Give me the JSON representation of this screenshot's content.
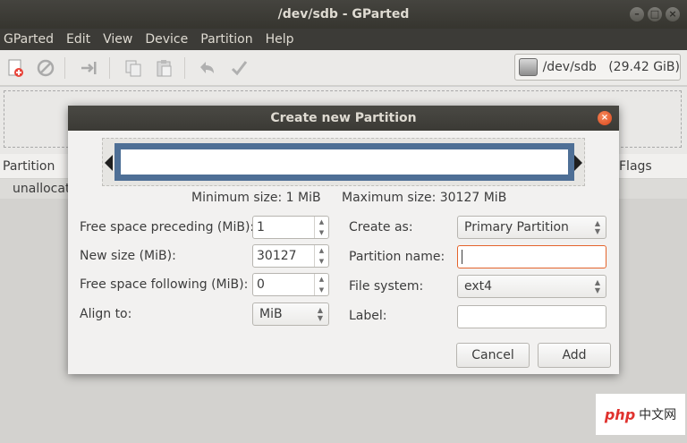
{
  "window": {
    "title": "/dev/sdb - GParted"
  },
  "menu": [
    "GParted",
    "Edit",
    "View",
    "Device",
    "Partition",
    "Help"
  ],
  "device": {
    "label": "/dev/sdb   (29.42 GiB)"
  },
  "partition_list": {
    "columns": [
      "Partition",
      "Flags"
    ],
    "rows": [
      {
        "partition": "unallocated"
      }
    ]
  },
  "dialog": {
    "title": "Create new Partition",
    "min_size": "Minimum size: 1 MiB",
    "max_size": "Maximum size: 30127 MiB",
    "free_preceding": {
      "label": "Free space preceding (MiB):",
      "value": "1"
    },
    "new_size": {
      "label": "New size (MiB):",
      "value": "30127"
    },
    "free_following": {
      "label": "Free space following (MiB):",
      "value": "0"
    },
    "align_to": {
      "label": "Align to:",
      "value": "MiB"
    },
    "create_as": {
      "label": "Create as:",
      "value": "Primary Partition"
    },
    "partition_name": {
      "label": "Partition name:",
      "value": ""
    },
    "file_system": {
      "label": "File system:",
      "value": "ext4"
    },
    "fs_label": {
      "label": "Label:",
      "value": ""
    },
    "cancel": "Cancel",
    "add": "Add"
  },
  "watermark": {
    "brand": "php",
    "text": "中文网"
  }
}
